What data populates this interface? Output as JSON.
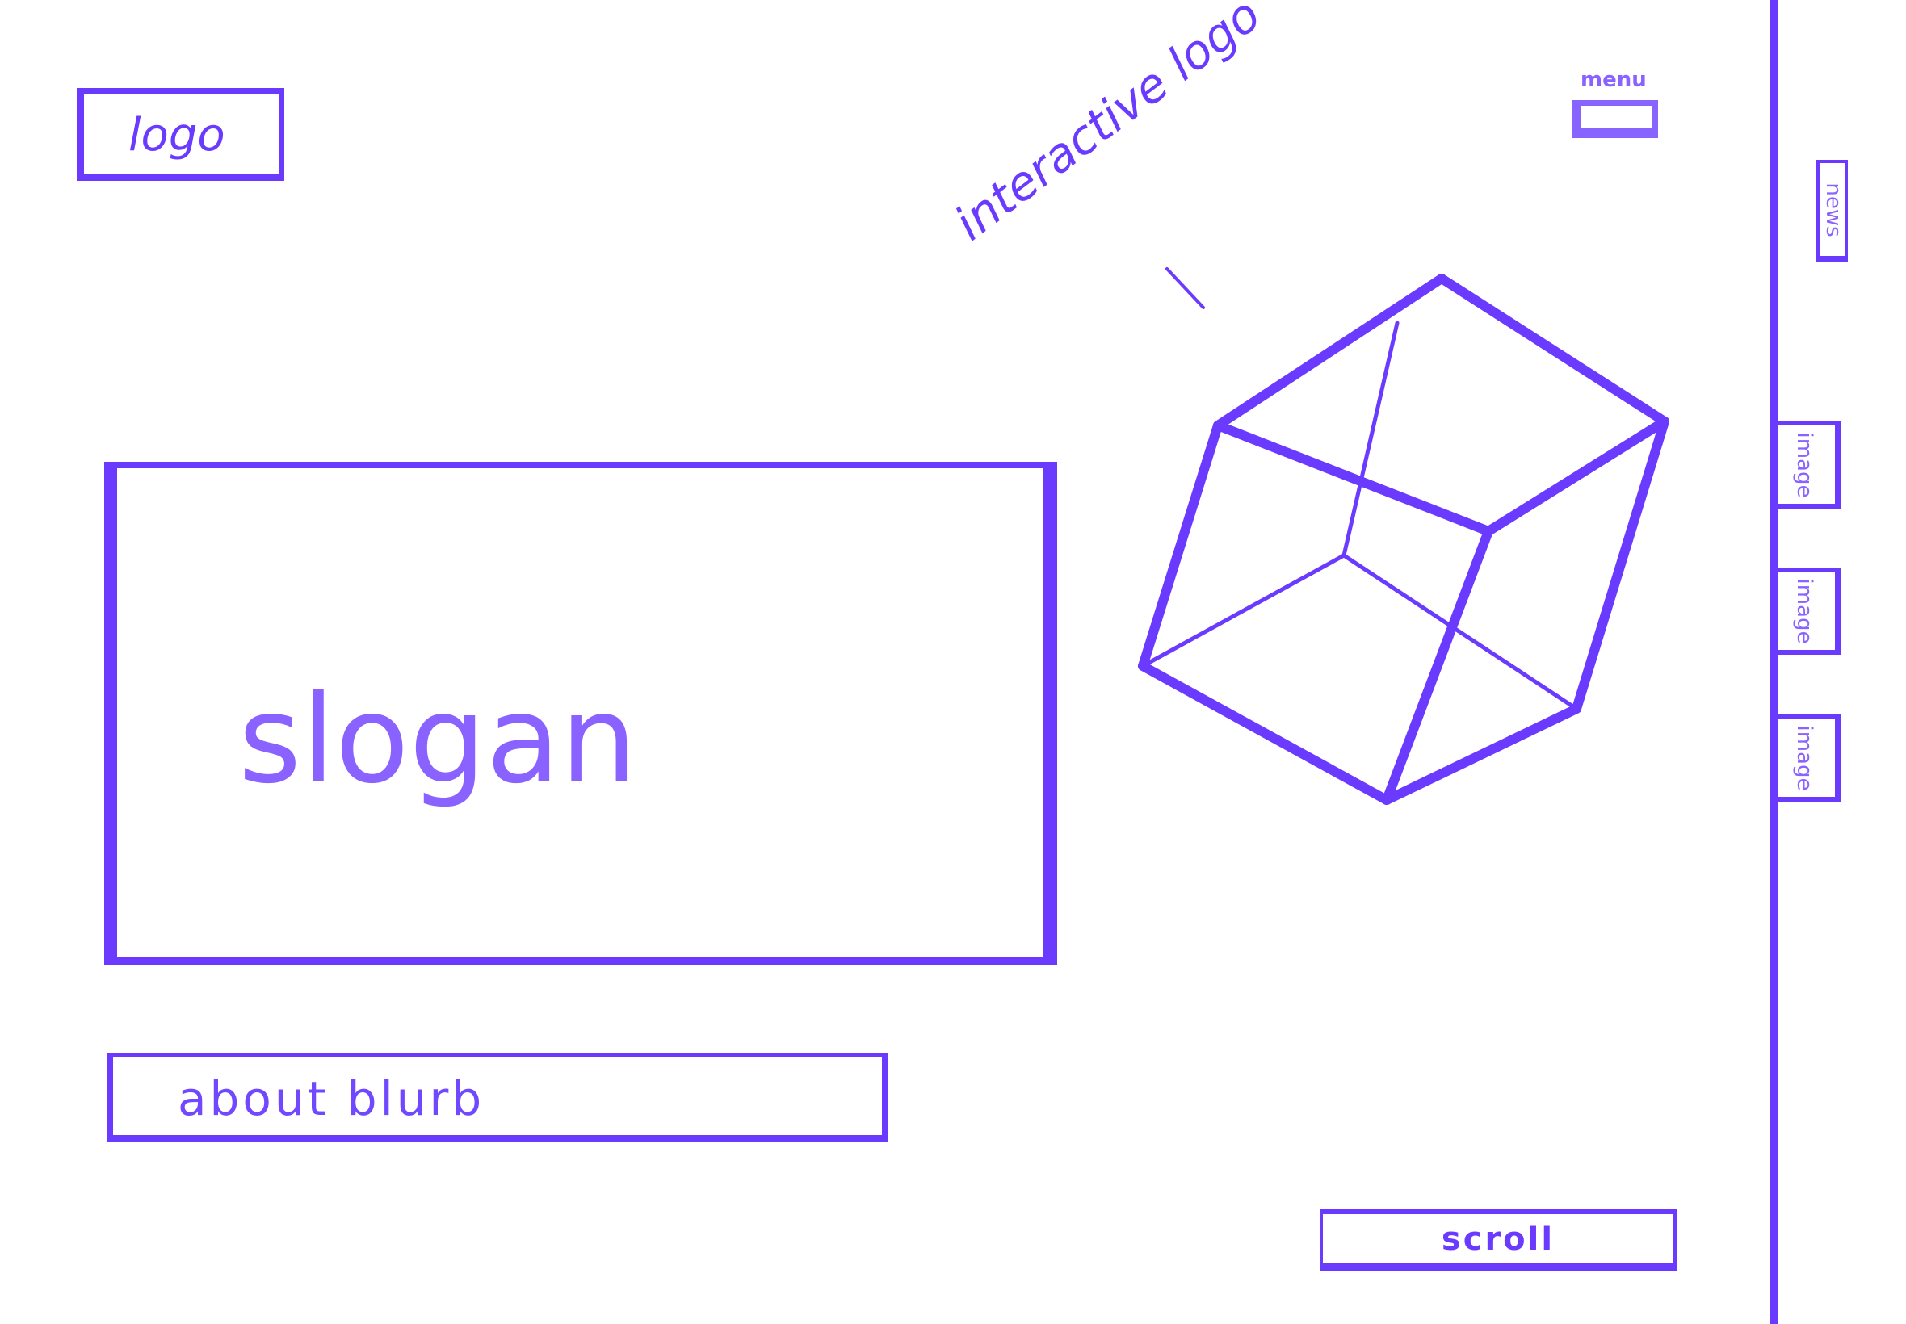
{
  "header": {
    "logo_label": "logo",
    "menu_label": "menu"
  },
  "hero": {
    "slogan": "slogan",
    "about": "about blurb"
  },
  "interactive": {
    "label": "interactive logo",
    "icon": "cube-icon"
  },
  "sidebar": {
    "news": "news",
    "images": [
      "image",
      "image",
      "image"
    ]
  },
  "footer": {
    "scroll_label": "scroll"
  },
  "colors": {
    "stroke": "#6a3bff",
    "text": "#8a62ff"
  }
}
